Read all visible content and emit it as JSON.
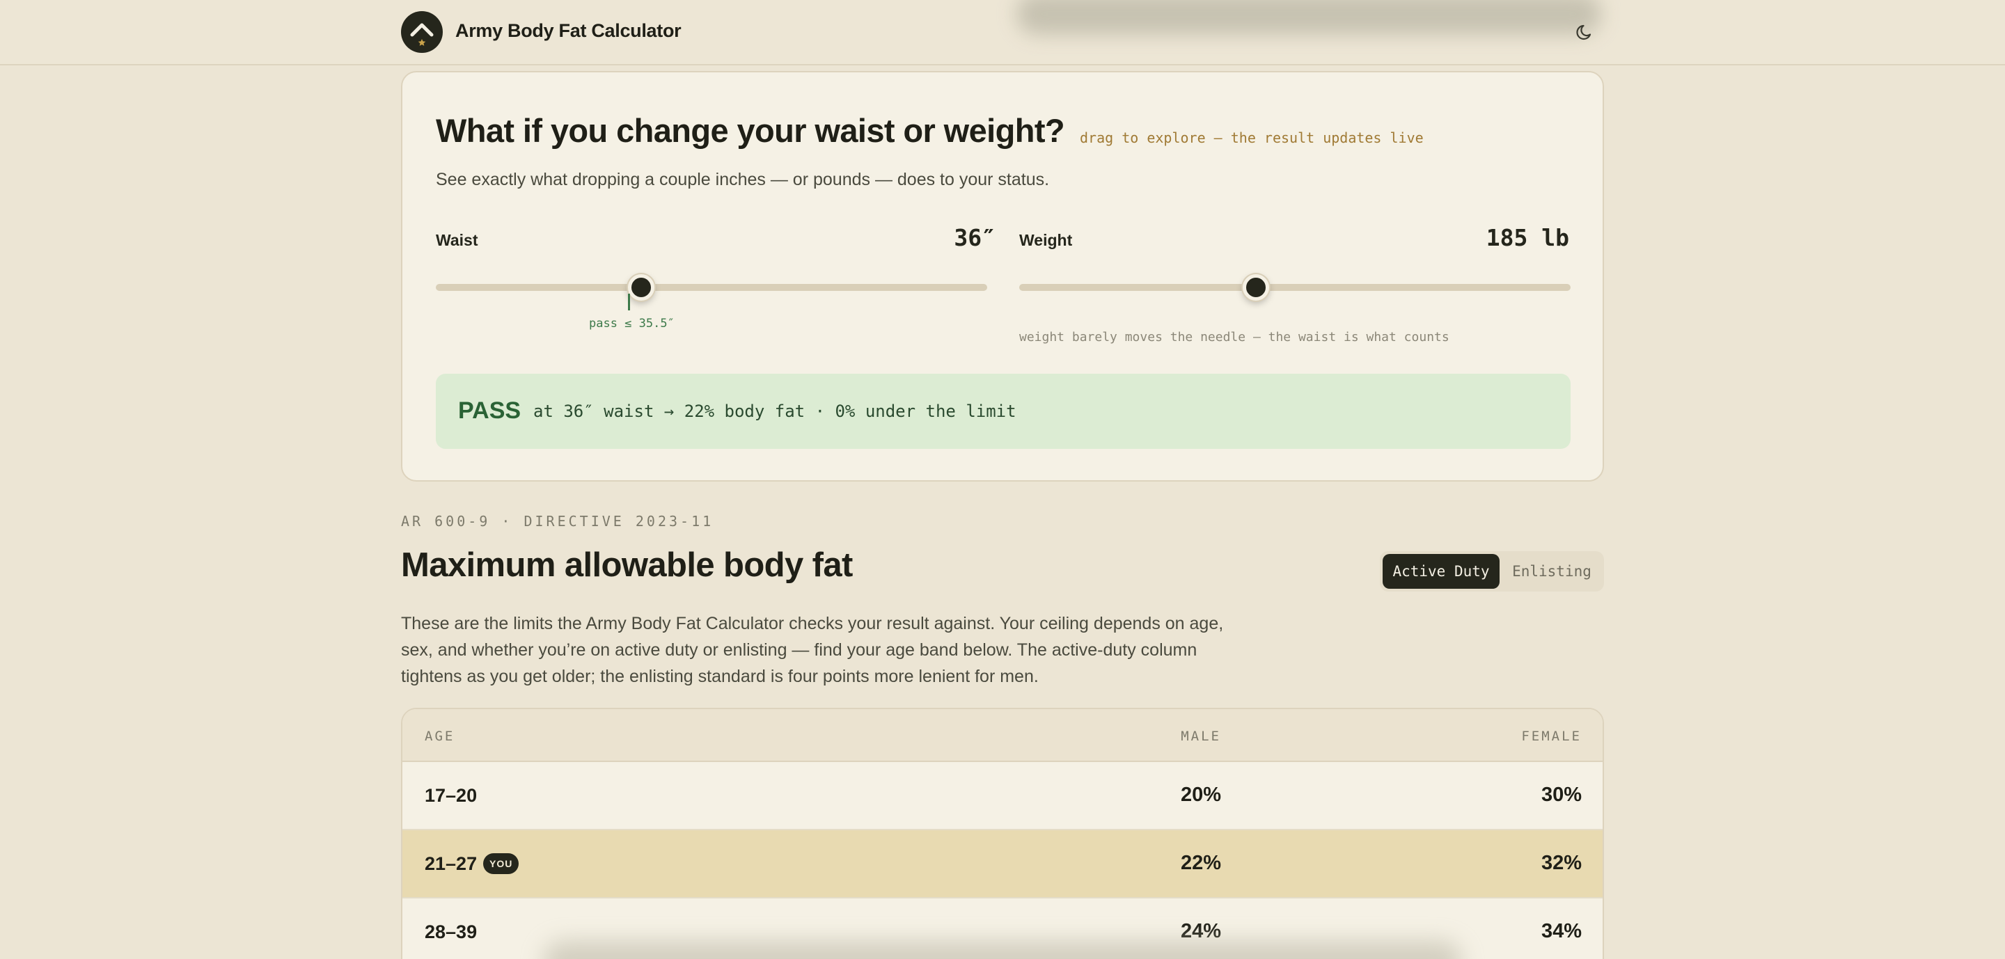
{
  "header": {
    "brand": "Army Body Fat Calculator",
    "icons": [
      "chevron-star-logo-icon",
      "moon-icon"
    ]
  },
  "whatif": {
    "title": "What if you change your waist or weight?",
    "hint": "drag to explore — the result updates live",
    "subtitle": "See exactly what dropping a couple inches — or pounds — does to your status.",
    "waist": {
      "label": "Waist",
      "value": "36″",
      "pass_note": "pass ≤ 35.5″"
    },
    "weight": {
      "label": "Weight",
      "value": "185 lb",
      "note": "weight barely moves the needle — the waist is what counts"
    },
    "result": {
      "status": "PASS",
      "detail": "at 36″ waist → 22% body fat · 0% under the limit"
    }
  },
  "standards": {
    "eyebrow": "AR 600-9 · DIRECTIVE 2023-11",
    "title": "Maximum allowable body fat",
    "toggle": {
      "active": "Active Duty",
      "inactive": "Enlisting"
    },
    "description": "These are the limits the Army Body Fat Calculator checks your result against. Your ceiling depends on age, sex, and whether you’re on active duty or enlisting — find your age band below. The active-duty column tightens as you get older; the enlisting standard is four points more lenient for men.",
    "table": {
      "headers": [
        "AGE",
        "MALE",
        "FEMALE"
      ],
      "you_badge": "YOU",
      "rows": [
        {
          "age": "17–20",
          "male": "20%",
          "female": "30%"
        },
        {
          "age": "21–27",
          "male": "22%",
          "female": "32%"
        },
        {
          "age": "28–39",
          "male": "24%",
          "female": "34%"
        }
      ]
    }
  },
  "colors": {
    "background": "#ece5d4",
    "ink": "#25261c",
    "pass_green": "#2a6235",
    "highlight_row": "#e8dab1",
    "accent_gold": "#a07a34"
  }
}
